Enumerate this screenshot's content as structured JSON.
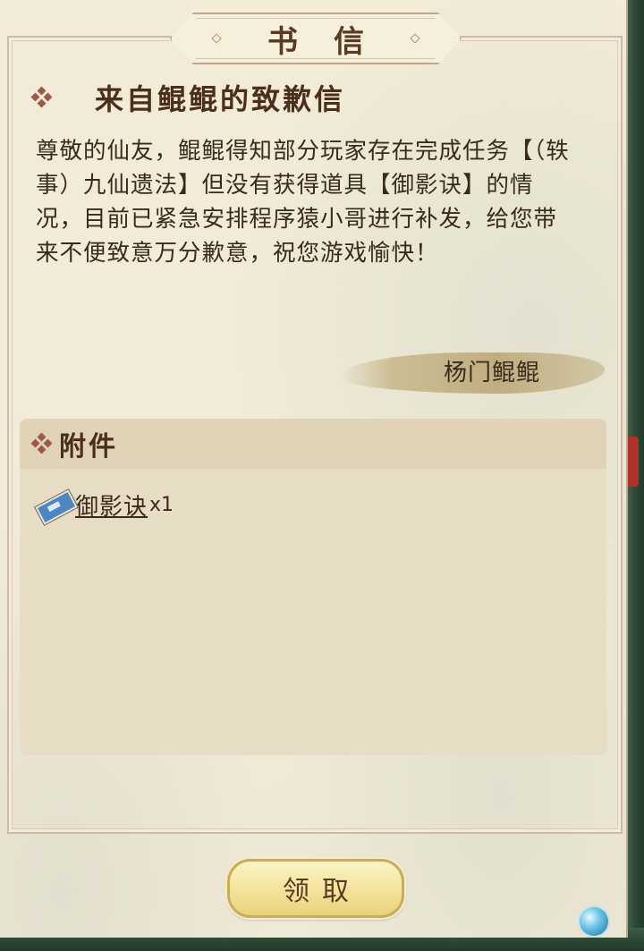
{
  "window": {
    "title": "书信"
  },
  "letter": {
    "heading": "来自鲲鲲的致歉信",
    "body": "尊敬的仙友，鲲鲲得知部分玩家存在完成任务【（轶事）九仙遗法】但没有获得道具【御影诀】的情况，目前已紧急安排程序猿小哥进行补发，给您带来不便致意万分歉意，祝您游戏愉快！",
    "signature": "杨门鲲鲲"
  },
  "attachments": {
    "title": "附件",
    "items": [
      {
        "name": "御影诀",
        "quantity": "x1",
        "icon": "scroll-icon"
      }
    ]
  },
  "actions": {
    "claim_label": "领取"
  },
  "colors": {
    "paper": "#f1ebd8",
    "heading": "#4b2f1c",
    "button": "#f3e39a",
    "accent": "#9c5a4a"
  }
}
